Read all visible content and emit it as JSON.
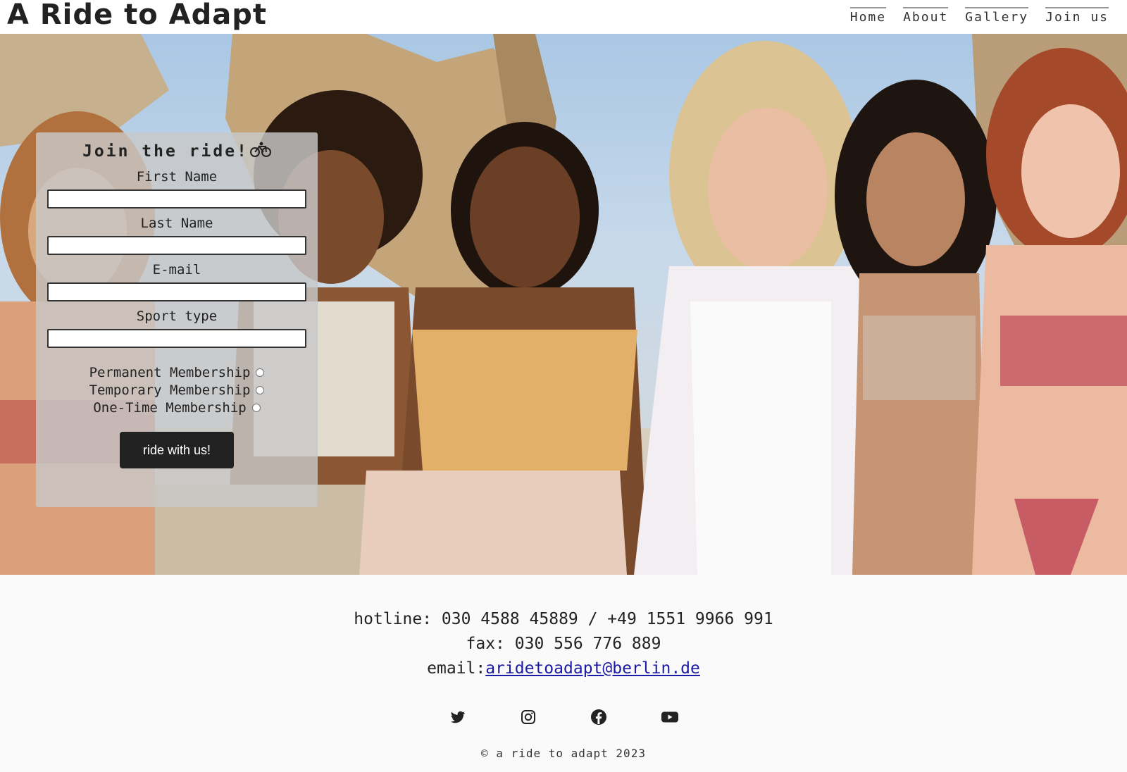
{
  "header": {
    "brand": "A Ride to Adapt",
    "nav": [
      {
        "label": "Home"
      },
      {
        "label": "About"
      },
      {
        "label": "Gallery"
      },
      {
        "label": "Join us"
      }
    ]
  },
  "form": {
    "title": "Join the ride!",
    "title_icon": "bicycle-icon",
    "fields": [
      {
        "label": "First Name",
        "value": ""
      },
      {
        "label": "Last Name",
        "value": ""
      },
      {
        "label": "E-mail",
        "value": ""
      },
      {
        "label": "Sport type",
        "value": ""
      }
    ],
    "memberships": [
      {
        "label": "Permanent Membership",
        "selected": false
      },
      {
        "label": "Temporary Membership",
        "selected": false
      },
      {
        "label": "One-Time Membership",
        "selected": false
      }
    ],
    "submit_label": "ride with us!"
  },
  "footer": {
    "hotline": "hotline: 030 4588 45889 / +49 1551 9966 991",
    "fax": "fax: 030 556 776 889",
    "email_prefix": "email:",
    "email": "aridetoadapt@berlin.de",
    "socials": [
      "twitter-icon",
      "instagram-icon",
      "facebook-icon",
      "youtube-icon"
    ],
    "copyright": "© a ride to adapt 2023"
  },
  "colors": {
    "button_bg": "#222222",
    "link": "#1a1aa6",
    "footer_bg": "#fafafa"
  }
}
